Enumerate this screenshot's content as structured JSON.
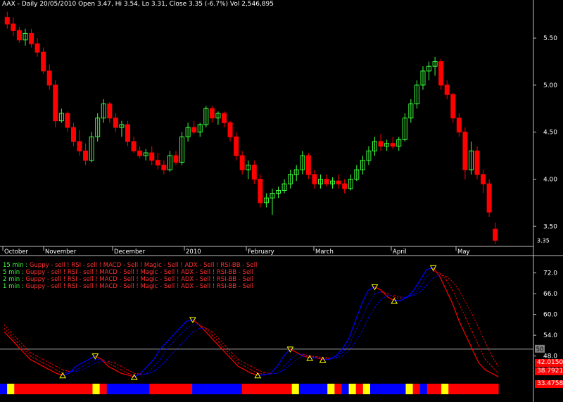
{
  "header": {
    "title": "AAX - Daily 20/05/2010 Open 3.47, Hi 3.54, Lo 3.31, Close 3.35 (-6.7%) Vol 2,546,895"
  },
  "price_axis": {
    "ticks": [
      "5.50",
      "5.00",
      "4.50",
      "4.00",
      "3.50"
    ],
    "last_label": "3.35"
  },
  "time_axis": {
    "labels": [
      "October",
      "November",
      "December",
      "2010",
      "February",
      "March",
      "April",
      "May"
    ]
  },
  "indicators": [
    {
      "name": "15 min :",
      "text": "Guppy - sell ! RSI - sell ! MACD - Sell ! Magic - Sell ! ADX - Sell ! RSI-BB - Sell"
    },
    {
      "name": "5 min :",
      "text": "Guppy - sell ! RSI - sell ! MACD - Sell ! Magic - Sell ! ADX - Sell ! RSI-BB - Sell"
    },
    {
      "name": "2 min :",
      "text": "Guppy - sell ! RSI - sell ! MACD - Sell ! Magic - Sell ! ADX - Sell ! RSI-BB - Sell"
    },
    {
      "name": "1 min :",
      "text": "Guppy - sell ! RSI - sell ! MACD - Sell ! Magic - Sell ! ADX - Sell ! RSI-BB - Sell"
    }
  ],
  "oscillator_axis": {
    "ticks": [
      "72.0",
      "66.0",
      "60.0",
      "54.0",
      "48.0"
    ],
    "level_label": "50",
    "value_tags": [
      "42.0150",
      "38.7921",
      "33.4758"
    ]
  },
  "colors": {
    "up": "#3cff3c",
    "down": "#ff0000",
    "blue": "#0000ff",
    "yellow": "#ffff00",
    "axis": "#c0c0c0"
  },
  "chart_data": {
    "type": "candlestick",
    "price_ylim": [
      3.3,
      5.8
    ],
    "candles_ohlc": [
      [
        5.72,
        5.78,
        5.6,
        5.65
      ],
      [
        5.65,
        5.72,
        5.52,
        5.58
      ],
      [
        5.58,
        5.62,
        5.45,
        5.48
      ],
      [
        5.48,
        5.6,
        5.42,
        5.55
      ],
      [
        5.55,
        5.6,
        5.4,
        5.44
      ],
      [
        5.44,
        5.5,
        5.3,
        5.35
      ],
      [
        5.35,
        5.4,
        5.12,
        5.15
      ],
      [
        5.15,
        5.22,
        4.95,
        5.0
      ],
      [
        5.0,
        5.05,
        4.55,
        4.62
      ],
      [
        4.62,
        4.75,
        4.6,
        4.7
      ],
      [
        4.7,
        4.72,
        4.5,
        4.55
      ],
      [
        4.55,
        4.6,
        4.35,
        4.4
      ],
      [
        4.4,
        4.52,
        4.25,
        4.3
      ],
      [
        4.3,
        4.38,
        4.15,
        4.2
      ],
      [
        4.2,
        4.5,
        4.18,
        4.45
      ],
      [
        4.45,
        4.7,
        4.4,
        4.65
      ],
      [
        4.65,
        4.85,
        4.6,
        4.8
      ],
      [
        4.8,
        4.82,
        4.6,
        4.65
      ],
      [
        4.65,
        4.7,
        4.5,
        4.55
      ],
      [
        4.55,
        4.62,
        4.45,
        4.58
      ],
      [
        4.58,
        4.62,
        4.35,
        4.4
      ],
      [
        4.4,
        4.45,
        4.28,
        4.3
      ],
      [
        4.3,
        4.35,
        4.22,
        4.25
      ],
      [
        4.25,
        4.32,
        4.2,
        4.28
      ],
      [
        4.28,
        4.35,
        4.15,
        4.2
      ],
      [
        4.2,
        4.28,
        4.1,
        4.15
      ],
      [
        4.15,
        4.2,
        4.05,
        4.1
      ],
      [
        4.1,
        4.3,
        4.08,
        4.25
      ],
      [
        4.25,
        4.3,
        4.15,
        4.18
      ],
      [
        4.18,
        4.5,
        4.15,
        4.45
      ],
      [
        4.45,
        4.6,
        4.4,
        4.55
      ],
      [
        4.55,
        4.62,
        4.48,
        4.5
      ],
      [
        4.5,
        4.6,
        4.45,
        4.58
      ],
      [
        4.58,
        4.78,
        4.55,
        4.75
      ],
      [
        4.75,
        4.78,
        4.6,
        4.65
      ],
      [
        4.65,
        4.72,
        4.58,
        4.7
      ],
      [
        4.7,
        4.72,
        4.55,
        4.6
      ],
      [
        4.6,
        4.62,
        4.4,
        4.45
      ],
      [
        4.45,
        4.5,
        4.2,
        4.25
      ],
      [
        4.25,
        4.3,
        4.05,
        4.1
      ],
      [
        4.1,
        4.2,
        4.0,
        4.15
      ],
      [
        4.15,
        4.2,
        3.95,
        4.0
      ],
      [
        4.0,
        4.05,
        3.7,
        3.75
      ],
      [
        3.75,
        3.85,
        3.7,
        3.8
      ],
      [
        3.8,
        3.9,
        3.62,
        3.85
      ],
      [
        3.85,
        3.92,
        3.8,
        3.88
      ],
      [
        3.88,
        4.0,
        3.85,
        3.95
      ],
      [
        3.95,
        4.1,
        3.9,
        4.05
      ],
      [
        4.05,
        4.15,
        3.98,
        4.1
      ],
      [
        4.1,
        4.3,
        4.05,
        4.25
      ],
      [
        4.25,
        4.28,
        4.0,
        4.05
      ],
      [
        4.05,
        4.1,
        3.9,
        3.95
      ],
      [
        3.95,
        4.05,
        3.9,
        4.0
      ],
      [
        4.0,
        4.05,
        3.92,
        3.95
      ],
      [
        3.95,
        4.02,
        3.9,
        3.98
      ],
      [
        3.98,
        4.05,
        3.9,
        3.95
      ],
      [
        3.95,
        4.0,
        3.85,
        3.9
      ],
      [
        3.9,
        4.05,
        3.88,
        4.0
      ],
      [
        4.0,
        4.15,
        3.98,
        4.1
      ],
      [
        4.1,
        4.25,
        4.05,
        4.2
      ],
      [
        4.2,
        4.35,
        4.15,
        4.3
      ],
      [
        4.3,
        4.45,
        4.25,
        4.4
      ],
      [
        4.4,
        4.48,
        4.3,
        4.35
      ],
      [
        4.35,
        4.42,
        4.3,
        4.38
      ],
      [
        4.38,
        4.45,
        4.32,
        4.35
      ],
      [
        4.35,
        4.45,
        4.3,
        4.42
      ],
      [
        4.42,
        4.7,
        4.4,
        4.65
      ],
      [
        4.65,
        4.85,
        4.6,
        4.8
      ],
      [
        4.8,
        5.05,
        4.75,
        5.0
      ],
      [
        5.0,
        5.2,
        4.95,
        5.15
      ],
      [
        5.15,
        5.25,
        5.05,
        5.2
      ],
      [
        5.2,
        5.3,
        5.1,
        5.25
      ],
      [
        5.25,
        5.28,
        4.95,
        5.0
      ],
      [
        5.0,
        5.05,
        4.85,
        4.9
      ],
      [
        4.9,
        4.92,
        4.6,
        4.65
      ],
      [
        4.65,
        4.7,
        4.45,
        4.5
      ],
      [
        4.5,
        4.55,
        4.0,
        4.1
      ],
      [
        4.1,
        4.4,
        4.05,
        4.3
      ],
      [
        4.3,
        4.35,
        4.0,
        4.05
      ],
      [
        4.05,
        4.1,
        3.85,
        3.95
      ],
      [
        3.95,
        4.0,
        3.6,
        3.65
      ],
      [
        3.47,
        3.54,
        3.31,
        3.35
      ]
    ],
    "oscillator_ylim": [
      40,
      76
    ],
    "oscillator_series": [
      {
        "values": [
          55,
          53,
          51,
          49,
          47,
          46,
          45,
          44,
          43,
          42.5,
          43,
          45,
          46,
          47,
          48,
          47,
          45,
          44,
          43,
          42.5,
          42,
          43,
          45,
          47,
          50,
          52,
          54,
          56,
          58,
          58.5,
          57,
          55,
          53,
          51,
          49,
          47,
          45,
          44,
          43,
          42.5,
          42.5,
          43,
          45,
          48,
          50,
          49,
          48,
          47.5,
          47.5,
          47,
          47,
          48,
          50,
          53,
          58,
          63,
          67,
          68,
          67,
          65,
          64,
          64,
          65,
          67,
          70,
          73,
          73.5,
          71,
          67,
          63,
          58,
          54,
          50,
          46,
          44,
          43,
          42
        ]
      },
      {
        "values": [
          56,
          54,
          52,
          50,
          48,
          47,
          46,
          45,
          44,
          43,
          43.5,
          44,
          45,
          46,
          47,
          47,
          46,
          45,
          44,
          43,
          42.5,
          42.5,
          43,
          45,
          47,
          50,
          52,
          54,
          56,
          57,
          57,
          56,
          54,
          52,
          50,
          48,
          46,
          45,
          44,
          43,
          42.8,
          42.8,
          43,
          45,
          47,
          48.5,
          48.5,
          48,
          47.5,
          47.5,
          47.2,
          47.5,
          49,
          51,
          55,
          59,
          63,
          66,
          66.5,
          66,
          65,
          64.5,
          65,
          66,
          68,
          71,
          72.5,
          72,
          70,
          67,
          63,
          59,
          55,
          51,
          47,
          45,
          43
        ]
      },
      {
        "values": [
          57,
          55,
          53,
          51,
          49,
          48,
          47,
          46,
          45,
          44,
          43.5,
          43.5,
          44,
          45,
          46,
          46.5,
          46.5,
          46,
          45,
          44,
          43,
          42.8,
          42.8,
          43.5,
          45,
          47,
          49,
          51,
          53,
          55,
          56,
          56,
          55,
          53,
          51,
          49,
          47,
          46,
          45,
          44,
          43.2,
          43,
          43,
          44,
          45.5,
          47,
          48,
          48,
          47.8,
          47.6,
          47.4,
          47.4,
          48,
          49.5,
          52,
          55,
          59,
          62,
          64.5,
          65.5,
          65.5,
          65,
          65,
          65.5,
          66.5,
          68.5,
          70.5,
          71.5,
          71,
          69.5,
          67,
          63.5,
          60,
          56,
          52,
          48,
          45
        ]
      }
    ],
    "signal_bar": [
      "b",
      "y",
      "r",
      "r",
      "r",
      "r",
      "r",
      "r",
      "r",
      "r",
      "r",
      "r",
      "r",
      "y",
      "r",
      "b",
      "b",
      "b",
      "b",
      "b",
      "b",
      "r",
      "r",
      "r",
      "r",
      "r",
      "r",
      "b",
      "b",
      "b",
      "b",
      "b",
      "b",
      "b",
      "r",
      "r",
      "r",
      "r",
      "r",
      "r",
      "r",
      "y",
      "b",
      "b",
      "b",
      "b",
      "y",
      "r",
      "b",
      "y",
      "r",
      "y",
      "b",
      "b",
      "b",
      "b",
      "b",
      "y",
      "r",
      "b",
      "r",
      "r",
      "y",
      "r",
      "r",
      "r",
      "r",
      "r",
      "r",
      "r"
    ]
  }
}
